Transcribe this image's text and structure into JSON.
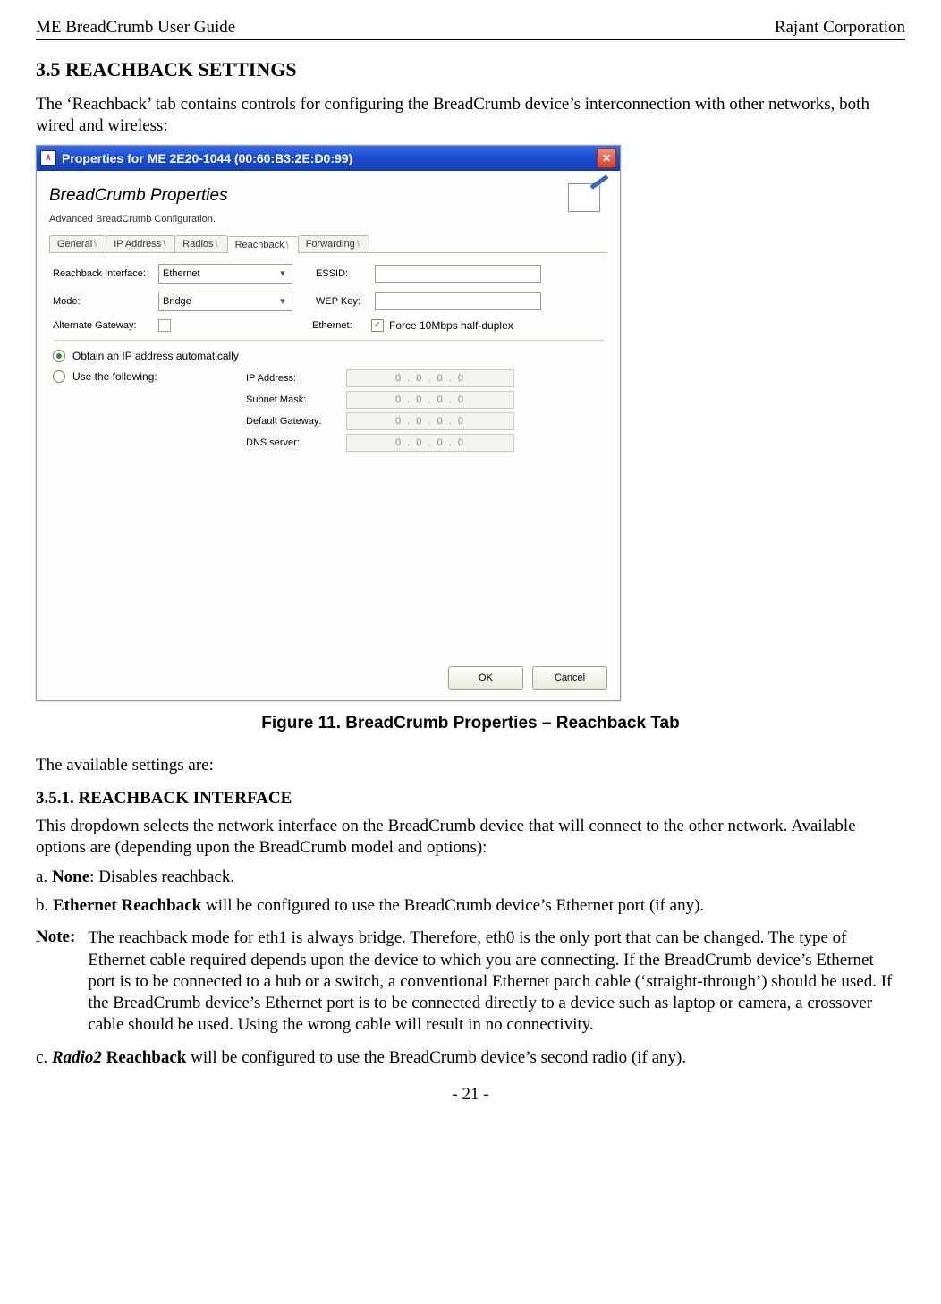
{
  "header": {
    "left": "ME BreadCrumb User Guide",
    "right": "Rajant Corporation"
  },
  "section_heading": "3.5 REACHBACK SETTINGS",
  "intro": "The ‘Reachback’ tab contains controls for configuring the BreadCrumb device’s interconnection with other networks, both wired and wireless:",
  "figure_caption": "Figure 11. BreadCrumb Properties – Reachback Tab",
  "available": "The available settings are:",
  "sub351": "3.5.1. REACHBACK INTERFACE",
  "sub351_p": "This dropdown selects the network interface on the BreadCrumb device that will connect to the other network. Available options are (depending upon the BreadCrumb model and options):",
  "item_a_pre": "a. ",
  "item_a_bold": "None",
  "item_a_post": ": Disables reachback.",
  "item_b_pre": "b. ",
  "item_b_bold": "Ethernet Reachback",
  "item_b_post": " will be configured to use the BreadCrumb device’s Ethernet port (if any).",
  "note_label": "Note:",
  "note_body": "The reachback mode for eth1 is always bridge. Therefore, eth0 is the only port that can be changed. The type of Ethernet cable required depends upon the device to which you are connecting. If the BreadCrumb device’s Ethernet port is to be connected to a hub or a switch, a conventional Ethernet patch cable (‘straight-through’) should be used. If the BreadCrumb device’s Ethernet port is to be connected directly to a device such as laptop or camera, a crossover cable should be used. Using the wrong cable will result in no connectivity.",
  "item_c_pre": "c. ",
  "item_c_ital": "Radio2",
  "item_c_bold": " Reachback",
  "item_c_post": " will be configured to use the BreadCrumb device’s second radio (if any).",
  "page_number": "- 21 -",
  "win": {
    "title": "Properties for ME 2E20-1044 (00:60:B3:2E:D0:99)",
    "panel_title": "BreadCrumb Properties",
    "panel_sub": "Advanced BreadCrumb Configuration.",
    "tabs": [
      "General",
      "IP Address",
      "Radios",
      "Reachback",
      "Forwarding"
    ],
    "active_tab": "Reachback",
    "labels": {
      "reachback_if": "Reachback Interface:",
      "mode": "Mode:",
      "alt_gw": "Alternate Gateway:",
      "essid": "ESSID:",
      "wep": "WEP Key:",
      "eth": "Ethernet:",
      "force": "Force 10Mbps half-duplex",
      "obtain": "Obtain an IP address automatically",
      "usefollow": "Use the following:",
      "ip": "IP Address:",
      "mask": "Subnet Mask:",
      "gw": "Default Gateway:",
      "dns": "DNS server:"
    },
    "values": {
      "reachback_if": "Ethernet",
      "mode": "Bridge",
      "ip_placeholder": "0 . 0 . 0 . 0"
    },
    "buttons": {
      "ok": "OK",
      "cancel": "Cancel"
    }
  }
}
